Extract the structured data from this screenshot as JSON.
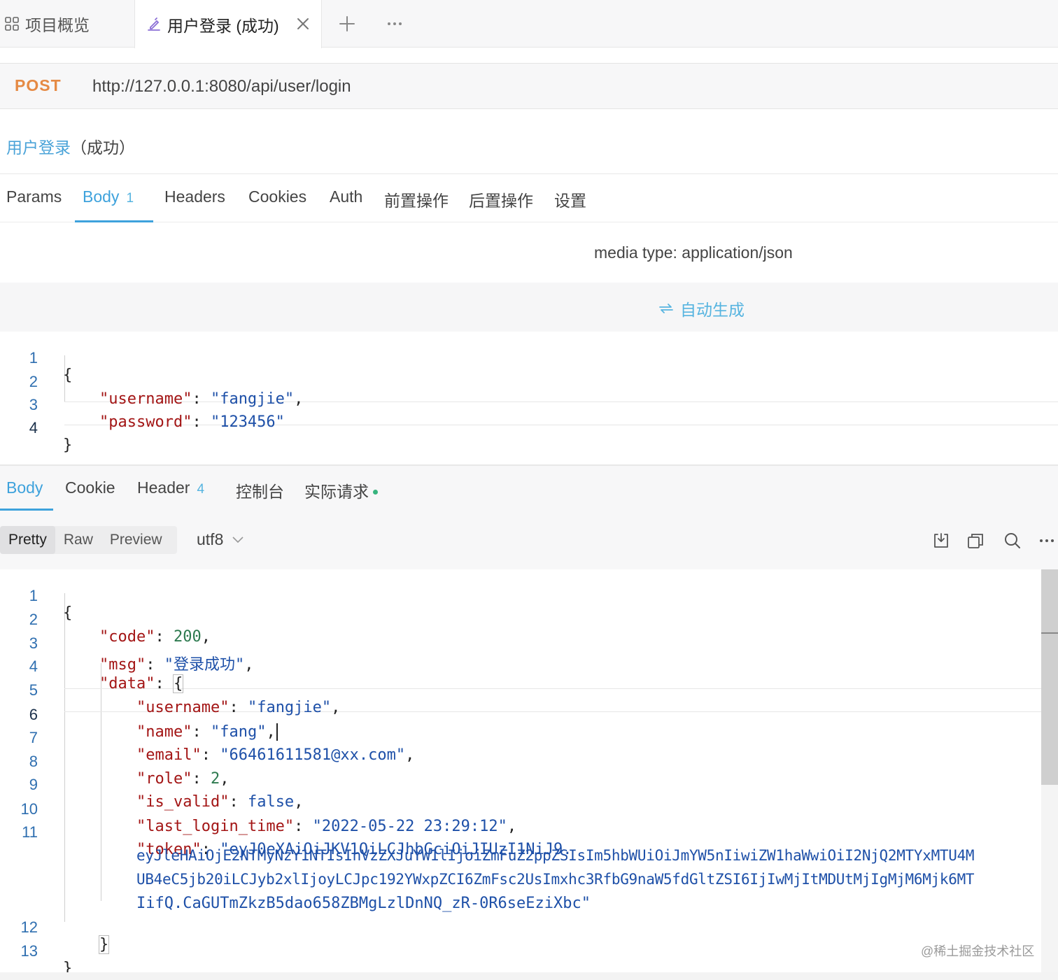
{
  "tabs": {
    "overview_label": "项目概览",
    "active_label": "用户登录 (成功)"
  },
  "request": {
    "method": "POST",
    "url": "http://127.0.0.1:8080/api/user/login",
    "name_link": "用户登录",
    "name_rest": "（成功）",
    "tabs": [
      {
        "label": "Params"
      },
      {
        "label": "Body",
        "badge": "1"
      },
      {
        "label": "Headers"
      },
      {
        "label": "Cookies"
      },
      {
        "label": "Auth"
      },
      {
        "label": "前置操作"
      },
      {
        "label": "后置操作"
      },
      {
        "label": "设置"
      }
    ],
    "media_type": "media type: application/json",
    "auto_generate": "自动生成",
    "body_code": {
      "line_numbers": [
        "1",
        "2",
        "3",
        "4"
      ],
      "open_brace": "{",
      "close_brace": "}",
      "username_key": "\"username\"",
      "username_value": "\"fangjie\"",
      "password_key": "\"password\"",
      "password_value": "\"123456\""
    }
  },
  "response": {
    "tabs": [
      {
        "label": "Body"
      },
      {
        "label": "Cookie"
      },
      {
        "label": "Header",
        "badge": "4"
      },
      {
        "label": "控制台"
      },
      {
        "label": "实际请求"
      }
    ],
    "formats": [
      "Pretty",
      "Raw",
      "Preview"
    ],
    "encoding": "utf8",
    "line_numbers": [
      "1",
      "2",
      "3",
      "4",
      "5",
      "6",
      "7",
      "8",
      "9",
      "10",
      "11",
      "12",
      "13"
    ],
    "json": {
      "code_key": "\"code\"",
      "code_value": "200",
      "msg_key": "\"msg\"",
      "msg_value": "\"登录成功\"",
      "data_key": "\"data\"",
      "username_key": "\"username\"",
      "username_value": "\"fangjie\"",
      "name_key": "\"name\"",
      "name_value": "\"fang\"",
      "email_key": "\"email\"",
      "email_value": "\"66461611581@xx.com\"",
      "role_key": "\"role\"",
      "role_value": "2",
      "is_valid_key": "\"is_valid\"",
      "is_valid_value": "false",
      "last_login_time_key": "\"last_login_time\"",
      "last_login_time_value": "\"2022-05-22 23:29:12\"",
      "token_key": "\"token\"",
      "token_line1": "\"eyJ0eXAiOiJKV1QiLCJhbGciOiJIUzI1NiJ9.",
      "token_line2": "eyJleHAiOjE2NTMyNzY1NTIsInVzZXJuYW1lIjoiZmFuZ2ppZSIsIm5hbWUiOiJmYW5nIiwiZW1haWwiOiI2NjQ2MTYxMTU4M",
      "token_line3": "UB4eC5jb20iLCJyb2xlIjoyLCJpc192YWxpZCI6ZmFsc2UsImxhc3RfbG9naW5fdGltZSI6IjIwMjItMDUtMjIgMjM6Mjk6MT",
      "token_line4": "IifQ.CaGUTmZkzB5dao658ZBMgLzlDnNQ_zR-0R6seEziXbc\""
    }
  },
  "watermark": "@稀土掘金技术社区",
  "colors": {
    "accent": "#3ea2dc",
    "method": "#e58a44",
    "json_key": "#a31515",
    "json_string": "#1e50a8",
    "json_number": "#2d7a4f",
    "status_dot": "#37b47e"
  }
}
